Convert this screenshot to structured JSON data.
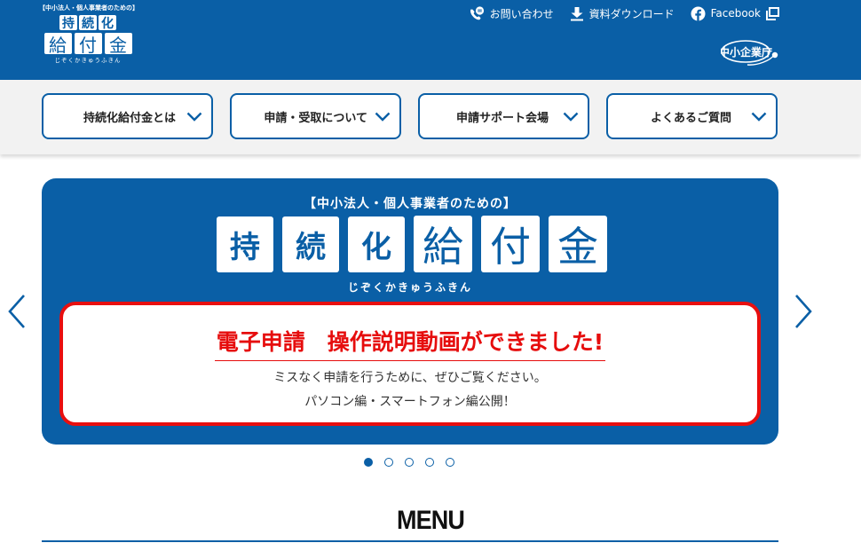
{
  "header": {
    "logo": {
      "tagline": "【中小法人・個人事業者のための】",
      "title_row1": [
        "持",
        "続",
        "化"
      ],
      "title_row2": [
        "給",
        "付",
        "金"
      ],
      "reading": "じぞくかきゅうふきん"
    },
    "utility_links": [
      {
        "label": "お問い合わせ",
        "icon": "phone-chat-icon"
      },
      {
        "label": "資料ダウンロード",
        "icon": "download-icon"
      },
      {
        "label": "Facebook",
        "icon": "facebook-icon",
        "trailing_icon": "external-window-icon"
      }
    ],
    "agency_logo": "中小企業庁"
  },
  "nav": {
    "items": [
      {
        "label": "持続化給付金とは"
      },
      {
        "label": "申請・受取について"
      },
      {
        "label": "申請サポート会場"
      },
      {
        "label": "よくあるご質問"
      }
    ]
  },
  "slider": {
    "slide": {
      "subtitle": "【中小法人・個人事業者のための】",
      "title_chars": [
        "持",
        "続",
        "化",
        "給",
        "付",
        "金"
      ],
      "reading": "じぞくかきゅうふきん",
      "headline": "電子申請　操作説明動画ができました!",
      "line1": "ミスなく申請を行うために、ぜひご覧ください。",
      "line2": "パソコン編・スマートフォン編公開！"
    },
    "total_slides": 5,
    "active_index": 0,
    "colors": {
      "brand": "#0a5fa6",
      "alert": "#e80f0f"
    }
  },
  "menu": {
    "title": "MENU"
  }
}
